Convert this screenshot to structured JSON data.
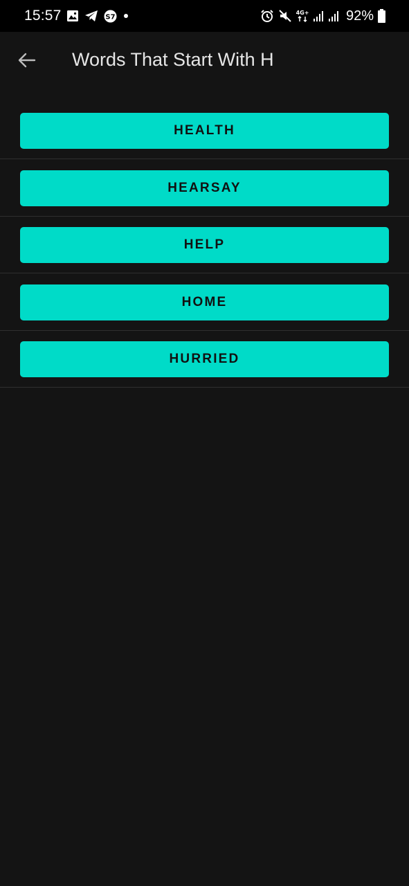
{
  "status_bar": {
    "time": "15:57",
    "network": "4G+",
    "battery_percent": "92%",
    "left_icons": [
      "image-icon",
      "telegram-icon",
      "s7-app-icon",
      "notification-dot-icon"
    ],
    "right_icons": [
      "alarm-icon",
      "mute-icon",
      "network-4g-icon",
      "signal-icon",
      "signal-icon",
      "battery-icon"
    ]
  },
  "app_bar": {
    "title": "Words That Start With H",
    "back_icon": "arrow-back-icon"
  },
  "words": [
    {
      "label": "HEALTH"
    },
    {
      "label": "HEARSAY"
    },
    {
      "label": "HELP"
    },
    {
      "label": "HOME"
    },
    {
      "label": "HURRIED"
    }
  ],
  "colors": {
    "background": "#141414",
    "status_bar": "#000000",
    "button": "#00dbc8",
    "button_text": "#111111",
    "divider": "#2f2f2f",
    "title_text": "#e6e6e6"
  }
}
